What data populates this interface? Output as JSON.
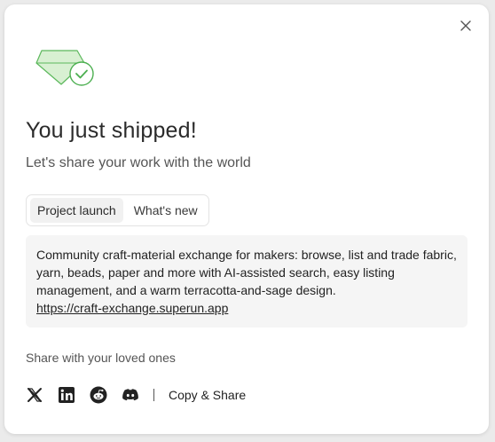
{
  "modal": {
    "title": "You just shipped!",
    "subtitle": "Let's share your work with the world",
    "tabs": [
      {
        "label": "Project launch",
        "active": true
      },
      {
        "label": "What's new",
        "active": false
      }
    ],
    "description": {
      "text": "Community craft-material exchange for makers: browse, list and trade fabric, yarn, beads, paper and more with AI-assisted search, easy listing management, and a warm terracotta-and-sage design.",
      "link": "https://craft-exchange.superun.app"
    },
    "share": {
      "label": "Share with your loved ones",
      "icons": [
        "x-icon",
        "linkedin-icon",
        "reddit-icon",
        "discord-icon"
      ],
      "copy_label": "Copy & Share"
    }
  },
  "colors": {
    "accent_green": "#4caf50",
    "gem_fill": "#d8f0d2"
  }
}
